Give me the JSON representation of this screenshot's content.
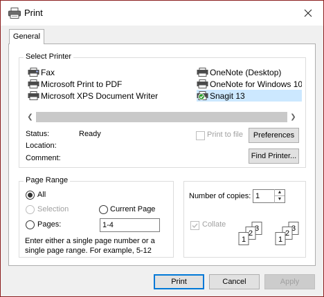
{
  "window": {
    "title": "Print",
    "close_icon": "close-icon"
  },
  "tabs": [
    {
      "label": "General",
      "active": true
    }
  ],
  "select_printer": {
    "legend": "Select Printer",
    "printers": [
      {
        "name": "Fax",
        "icon": "fax-printer-icon"
      },
      {
        "name": "Microsoft Print to PDF",
        "icon": "printer-icon"
      },
      {
        "name": "Microsoft XPS Document Writer",
        "icon": "printer-icon"
      },
      {
        "name": "OneNote (Desktop)",
        "icon": "printer-icon"
      },
      {
        "name": "OneNote for Windows 10",
        "icon": "printer-icon"
      },
      {
        "name": "Snagit 13",
        "icon": "default-printer-icon",
        "selected": true
      }
    ],
    "status_label": "Status:",
    "status_value": "Ready",
    "location_label": "Location:",
    "comment_label": "Comment:",
    "print_to_file_label": "Print to file",
    "preferences_label": "Preferences",
    "find_printer_label": "Find Printer..."
  },
  "page_range": {
    "legend": "Page Range",
    "all_label": "All",
    "selection_label": "Selection",
    "current_page_label": "Current Page",
    "pages_label": "Pages:",
    "pages_value": "1-4",
    "hint": "Enter either a single page number or a single page range.  For example, 5-12",
    "selected_option": "All"
  },
  "copies": {
    "number_label": "Number of copies:",
    "number_value": "1",
    "collate_label": "Collate",
    "collate_checked": true,
    "collate_enabled": false
  },
  "footer": {
    "print_label": "Print",
    "cancel_label": "Cancel",
    "apply_label": "Apply"
  },
  "colors": {
    "accent": "#0078d7",
    "selection_bg": "#cce8ff",
    "border": "#adadad"
  }
}
